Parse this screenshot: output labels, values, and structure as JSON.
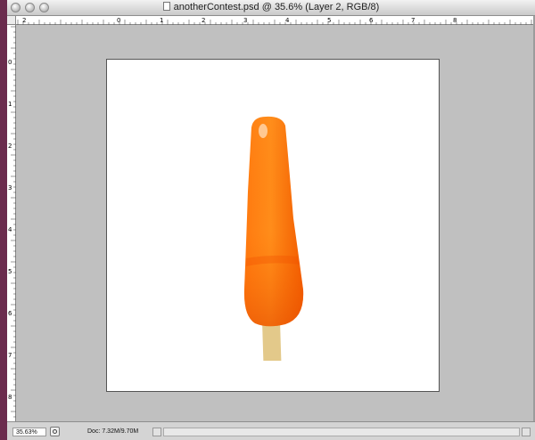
{
  "window": {
    "title": "anotherContest.psd @ 35.6% (Layer 2, RGB/8)"
  },
  "rulers": {
    "top_labels": [
      "2",
      "0",
      "1",
      "2",
      "3",
      "4",
      "5",
      "6",
      "7",
      "8"
    ],
    "left_labels": [
      "0",
      "1",
      "2",
      "3",
      "4",
      "5",
      "6",
      "7",
      "8"
    ]
  },
  "document": {
    "canvas_color": "#ffffff",
    "artwork": "orange-popsicle",
    "ice_color": "#ff6a00",
    "stick_color": "#e3c98a"
  },
  "statusbar": {
    "zoom": "35.63%",
    "doc_info": "Doc: 7.32M/9.70M"
  }
}
